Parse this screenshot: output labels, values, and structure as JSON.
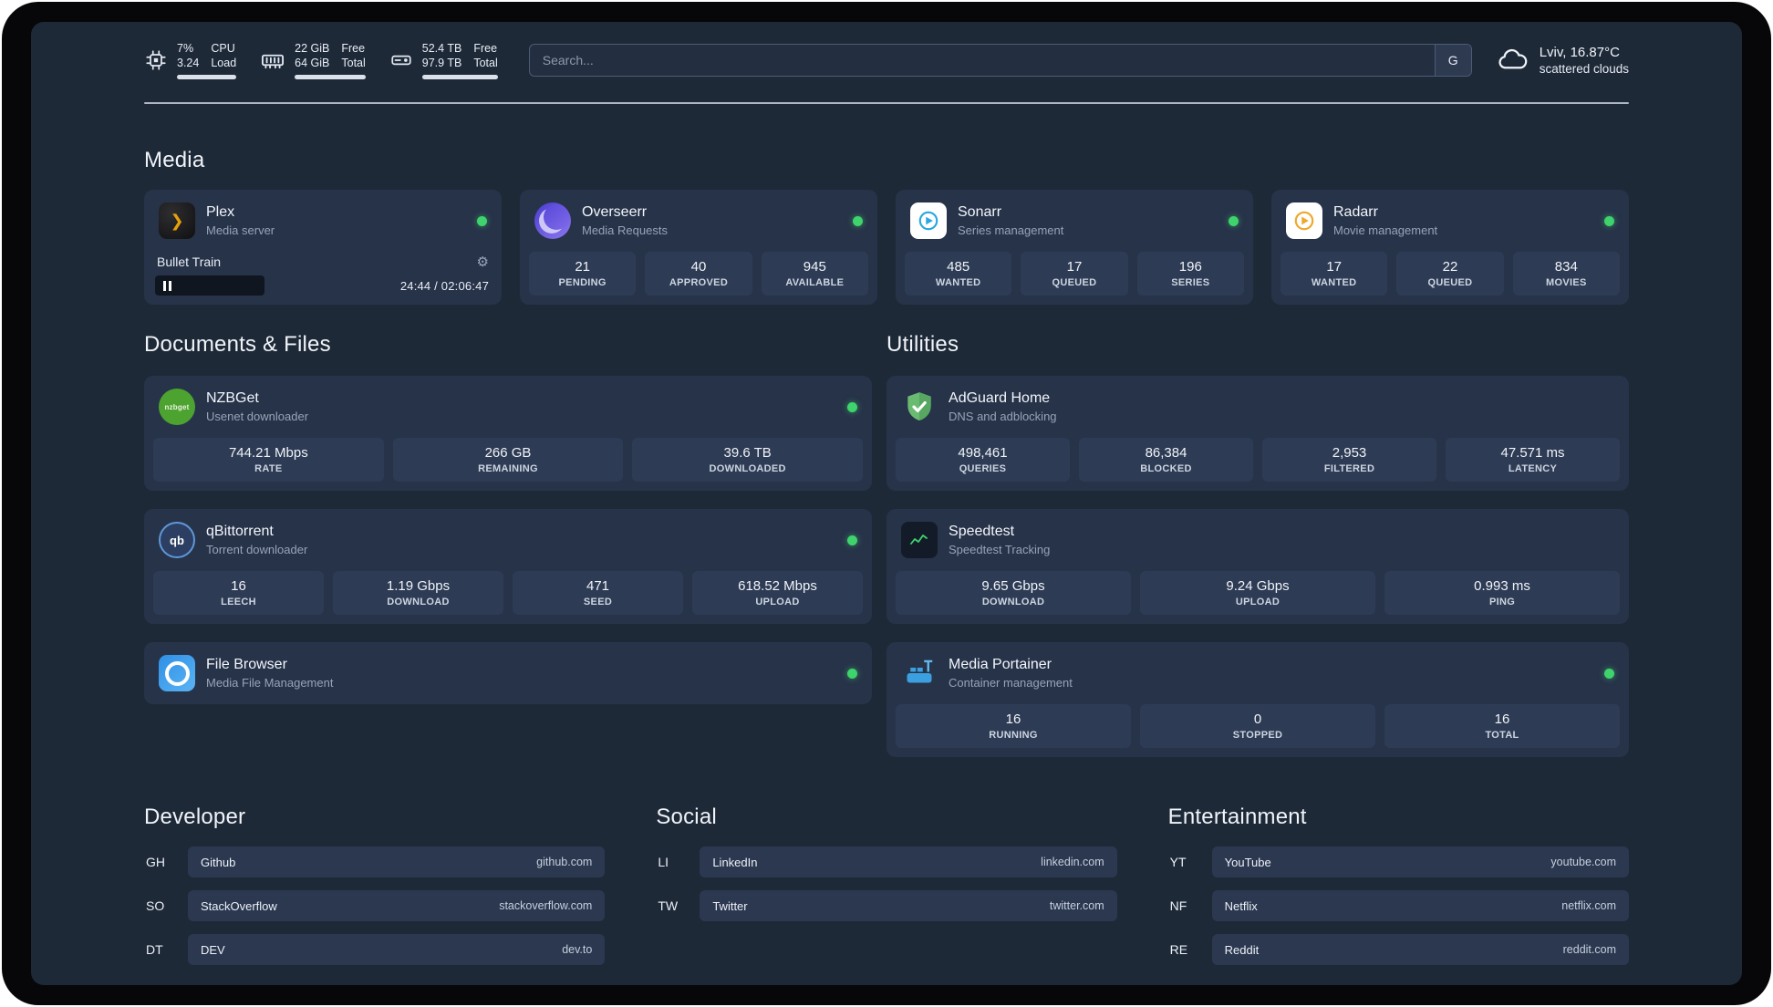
{
  "header": {
    "cpu": {
      "value_top": "7%",
      "value_bottom": "3.24",
      "label_top": "CPU",
      "label_bottom": "Load"
    },
    "ram": {
      "value_top": "22 GiB",
      "value_bottom": "64 GiB",
      "label_top": "Free",
      "label_bottom": "Total"
    },
    "disk": {
      "value_top": "52.4 TB",
      "value_bottom": "97.9 TB",
      "label_top": "Free",
      "label_bottom": "Total"
    },
    "search": {
      "placeholder": "Search...",
      "engine": "G"
    },
    "weather": {
      "location": "Lviv, 16.87°C",
      "condition": "scattered clouds"
    }
  },
  "icons": {
    "gear": "⚙",
    "plex_chevron": "❯"
  },
  "media": {
    "title": "Media",
    "plex": {
      "name": "Plex",
      "subtitle": "Media server",
      "now_playing": "Bullet Train",
      "time": "24:44 / 02:06:47"
    },
    "overseerr": {
      "name": "Overseerr",
      "subtitle": "Media Requests",
      "stats": [
        {
          "value": "21",
          "label": "PENDING"
        },
        {
          "value": "40",
          "label": "APPROVED"
        },
        {
          "value": "945",
          "label": "AVAILABLE"
        }
      ]
    },
    "sonarr": {
      "name": "Sonarr",
      "subtitle": "Series management",
      "stats": [
        {
          "value": "485",
          "label": "WANTED"
        },
        {
          "value": "17",
          "label": "QUEUED"
        },
        {
          "value": "196",
          "label": "SERIES"
        }
      ]
    },
    "radarr": {
      "name": "Radarr",
      "subtitle": "Movie management",
      "stats": [
        {
          "value": "17",
          "label": "WANTED"
        },
        {
          "value": "22",
          "label": "QUEUED"
        },
        {
          "value": "834",
          "label": "MOVIES"
        }
      ]
    }
  },
  "documents": {
    "title": "Documents & Files",
    "nzbget": {
      "name": "NZBGet",
      "subtitle": "Usenet downloader",
      "icon_text": "nzbget",
      "stats": [
        {
          "value": "744.21 Mbps",
          "label": "RATE"
        },
        {
          "value": "266 GB",
          "label": "REMAINING"
        },
        {
          "value": "39.6 TB",
          "label": "DOWNLOADED"
        }
      ]
    },
    "qbittorrent": {
      "name": "qBittorrent",
      "subtitle": "Torrent downloader",
      "icon_text": "qb",
      "stats": [
        {
          "value": "16",
          "label": "LEECH"
        },
        {
          "value": "1.19 Gbps",
          "label": "DOWNLOAD"
        },
        {
          "value": "471",
          "label": "SEED"
        },
        {
          "value": "618.52 Mbps",
          "label": "UPLOAD"
        }
      ]
    },
    "filebrowser": {
      "name": "File Browser",
      "subtitle": "Media File Management"
    }
  },
  "utilities": {
    "title": "Utilities",
    "adguard": {
      "name": "AdGuard Home",
      "subtitle": "DNS and adblocking",
      "stats": [
        {
          "value": "498,461",
          "label": "QUERIES"
        },
        {
          "value": "86,384",
          "label": "BLOCKED"
        },
        {
          "value": "2,953",
          "label": "FILTERED"
        },
        {
          "value": "47.571 ms",
          "label": "LATENCY"
        }
      ]
    },
    "speedtest": {
      "name": "Speedtest",
      "subtitle": "Speedtest Tracking",
      "stats": [
        {
          "value": "9.65 Gbps",
          "label": "DOWNLOAD"
        },
        {
          "value": "9.24 Gbps",
          "label": "UPLOAD"
        },
        {
          "value": "0.993 ms",
          "label": "PING"
        }
      ]
    },
    "portainer": {
      "name": "Media Portainer",
      "subtitle": "Container management",
      "stats": [
        {
          "value": "16",
          "label": "RUNNING"
        },
        {
          "value": "0",
          "label": "STOPPED"
        },
        {
          "value": "16",
          "label": "TOTAL"
        }
      ]
    }
  },
  "bookmarks": {
    "developer": {
      "title": "Developer",
      "items": [
        {
          "abbr": "GH",
          "name": "Github",
          "url": "github.com"
        },
        {
          "abbr": "SO",
          "name": "StackOverflow",
          "url": "stackoverflow.com"
        },
        {
          "abbr": "DT",
          "name": "DEV",
          "url": "dev.to"
        }
      ]
    },
    "social": {
      "title": "Social",
      "items": [
        {
          "abbr": "LI",
          "name": "LinkedIn",
          "url": "linkedin.com"
        },
        {
          "abbr": "TW",
          "name": "Twitter",
          "url": "twitter.com"
        }
      ]
    },
    "entertainment": {
      "title": "Entertainment",
      "items": [
        {
          "abbr": "YT",
          "name": "YouTube",
          "url": "youtube.com"
        },
        {
          "abbr": "NF",
          "name": "Netflix",
          "url": "netflix.com"
        },
        {
          "abbr": "RE",
          "name": "Reddit",
          "url": "reddit.com"
        }
      ]
    }
  }
}
